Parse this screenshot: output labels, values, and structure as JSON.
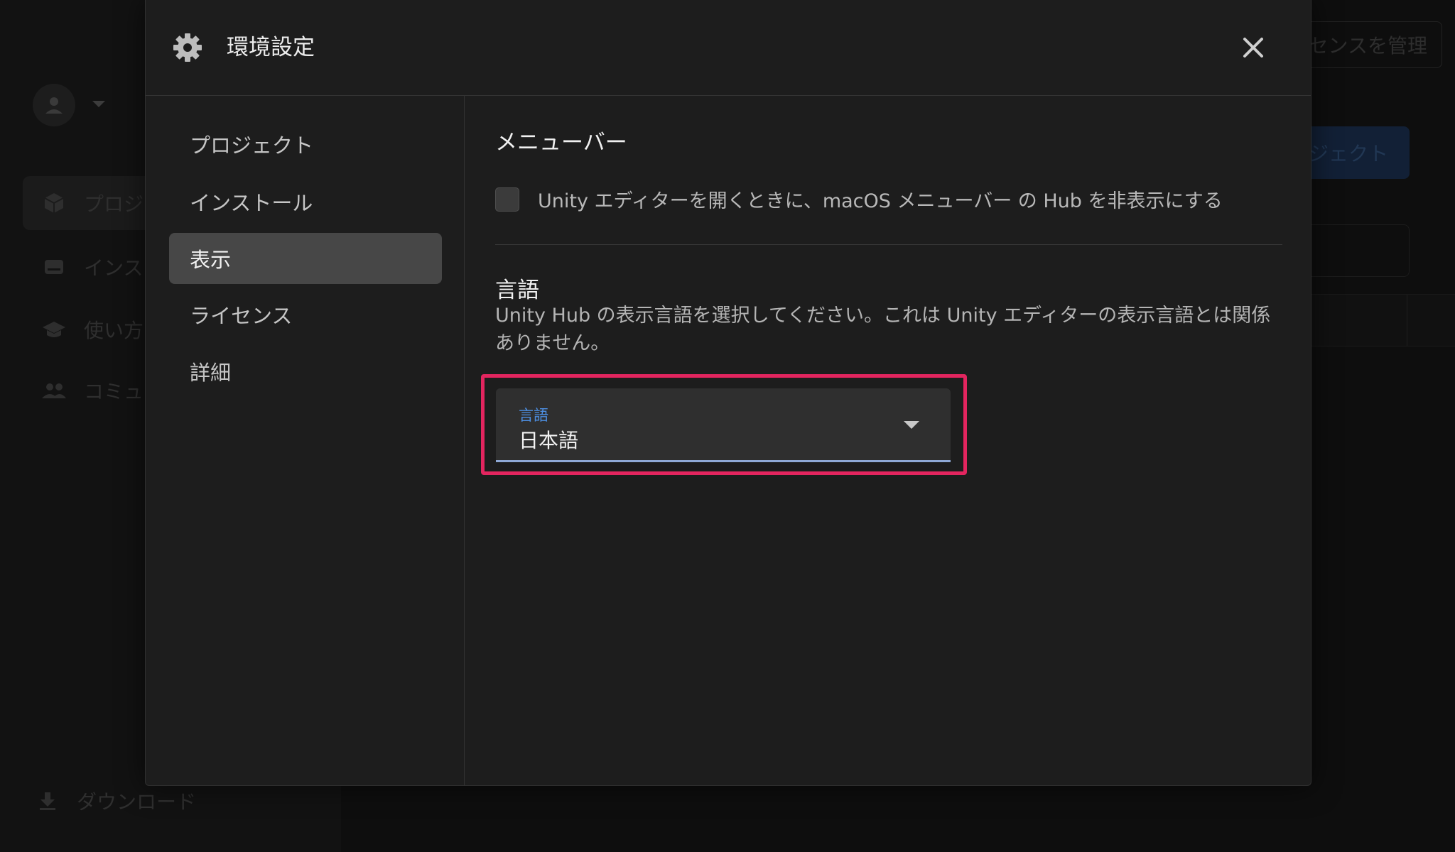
{
  "window": {
    "traffic_lights": {
      "close": "#fe5f57",
      "minimize": "#febc2e",
      "zoom": "#28c840"
    }
  },
  "background_app": {
    "nav_items": [
      {
        "label": "プロジ",
        "icon": "cube-icon"
      },
      {
        "label": "インス",
        "icon": "drive-icon"
      },
      {
        "label": "使い方",
        "icon": "graduation-cap-icon"
      },
      {
        "label": "コミュ",
        "icon": "people-icon"
      }
    ],
    "download_label": "ダウンロード",
    "top_button_label": "センスを管理",
    "new_project_button_label": "ジェクト"
  },
  "dialog": {
    "title": "環境設定",
    "nav": [
      {
        "label": "プロジェクト",
        "active": false
      },
      {
        "label": "インストール",
        "active": false
      },
      {
        "label": "表示",
        "active": true
      },
      {
        "label": "ライセンス",
        "active": false
      },
      {
        "label": "詳細",
        "active": false
      }
    ],
    "menubar": {
      "title": "メニューバー",
      "checkbox_label": "Unity エディターを開くときに、macOS メニューバー の Hub を非表示にする",
      "checked": false
    },
    "language": {
      "title": "言語",
      "description": "Unity Hub の表示言語を選択してください。これは Unity エディターの表示言語とは関係ありません。",
      "select_label": "言語",
      "selected_value": "日本語"
    }
  },
  "colors": {
    "highlight": "#e3255f",
    "accent": "#4d8fe3",
    "dialog_bg": "#1d1d1d",
    "active_nav_bg": "#474747"
  }
}
